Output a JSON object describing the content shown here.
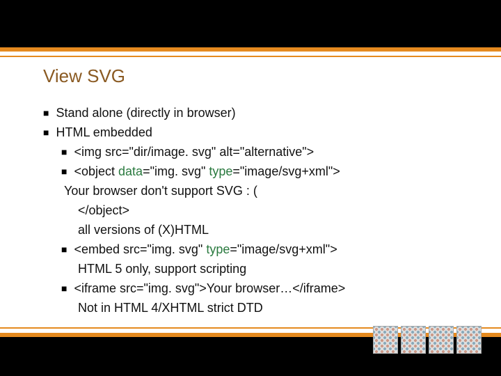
{
  "heading": "View SVG",
  "items": [
    "Stand alone (directly in browser)",
    "HTML embedded"
  ],
  "sub": {
    "img_tag": "<img src=\"dir/image. svg\" alt=\"alternative\">",
    "object_open_1": "<object ",
    "object_kw1": "data",
    "object_mid1": "=\"img. svg\" ",
    "object_kw2": "type",
    "object_end1": "=\"image/svg+xml\">",
    "object_inner": "Your browser don't support SVG : (",
    "object_close": "</object>",
    "object_note": "all versions of (X)HTML",
    "embed_1": "<embed src=\"img. svg\" ",
    "embed_kw": "type",
    "embed_2": "=\"image/svg+xml\">",
    "embed_note": "HTML 5 only, support scripting",
    "iframe_line": "<iframe src=\"img. svg\">Your browser…</iframe>",
    "iframe_note": "Not in HTML 4/XHTML strict DTD"
  }
}
